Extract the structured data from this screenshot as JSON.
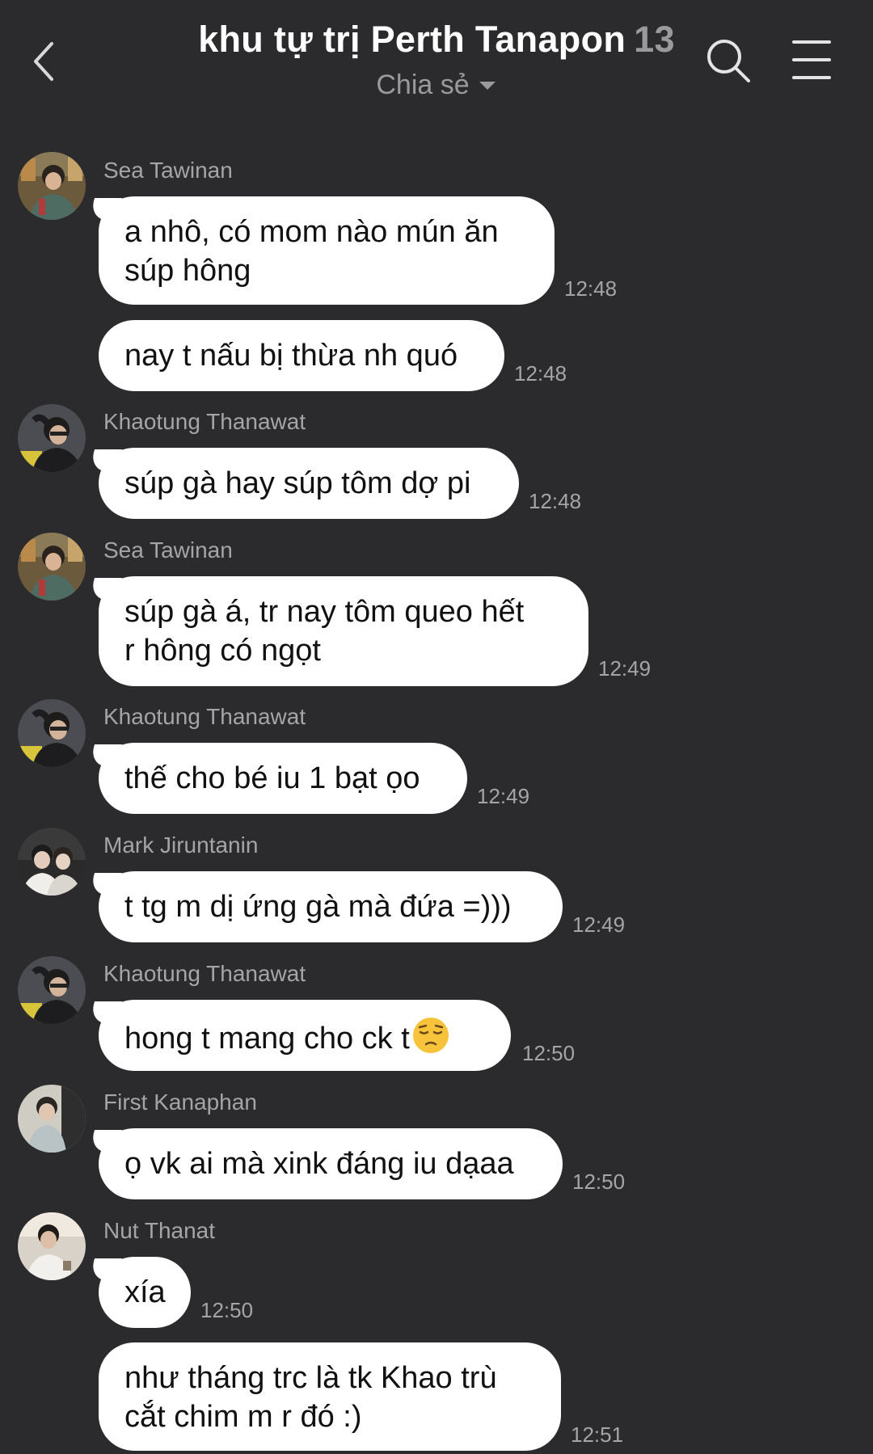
{
  "header": {
    "title": "khu tự trị Perth Tanapon",
    "member_count": "13",
    "subtitle": "Chia sẻ",
    "icons": {
      "back": "chevron-left-icon",
      "subtitle_caret": "caret-down-icon",
      "search": "search-icon",
      "menu": "hamburger-menu-icon"
    }
  },
  "messages": [
    {
      "sender": "Sea Tawinan",
      "lines": [
        "a nhô, có mom nào mún ăn",
        "súp hông"
      ],
      "time": "12:48"
    },
    {
      "lines": [
        "nay t nấu bị thừa nh quó"
      ],
      "time": "12:48"
    },
    {
      "sender": "Khaotung Thanawat",
      "lines": [
        "súp gà hay súp tôm dợ pi"
      ],
      "time": "12:48"
    },
    {
      "sender": "Sea Tawinan",
      "lines": [
        "súp gà á, tr nay tôm queo hết",
        "r hông có ngọt"
      ],
      "time": "12:49"
    },
    {
      "sender": "Khaotung Thanawat",
      "lines": [
        "thế cho bé iu 1 bạt ọo"
      ],
      "time": "12:49"
    },
    {
      "sender": "Mark Jiruntanin",
      "lines": [
        "t tg m dị ứng gà mà đứa =)))"
      ],
      "time": "12:49"
    },
    {
      "sender": "Khaotung Thanawat",
      "lines": [
        "hong t mang cho ck t"
      ],
      "emoji": "pensive-face-emoji",
      "time": "12:50"
    },
    {
      "sender": "First Kanaphan",
      "lines": [
        "ọ vk ai mà xink đáng iu dạaa"
      ],
      "time": "12:50"
    },
    {
      "sender": "Nut Thanat",
      "lines": [
        "xía"
      ],
      "time": "12:50"
    },
    {
      "lines": [
        "như tháng trc là tk Khao trù",
        "cắt chim m r đó :)"
      ],
      "time": "12:51"
    }
  ],
  "avatars": {
    "Sea Tawinan": "avatar-photo",
    "Khaotung Thanawat": "avatar-photo",
    "Mark Jiruntanin": "avatar-photo",
    "First Kanaphan": "avatar-photo",
    "Nut Thanat": "avatar-photo"
  },
  "colors": {
    "background": "#2b2b2d",
    "bubble": "#ffffff",
    "bubble_text": "#111111",
    "secondary_text": "#a5a5a7"
  }
}
